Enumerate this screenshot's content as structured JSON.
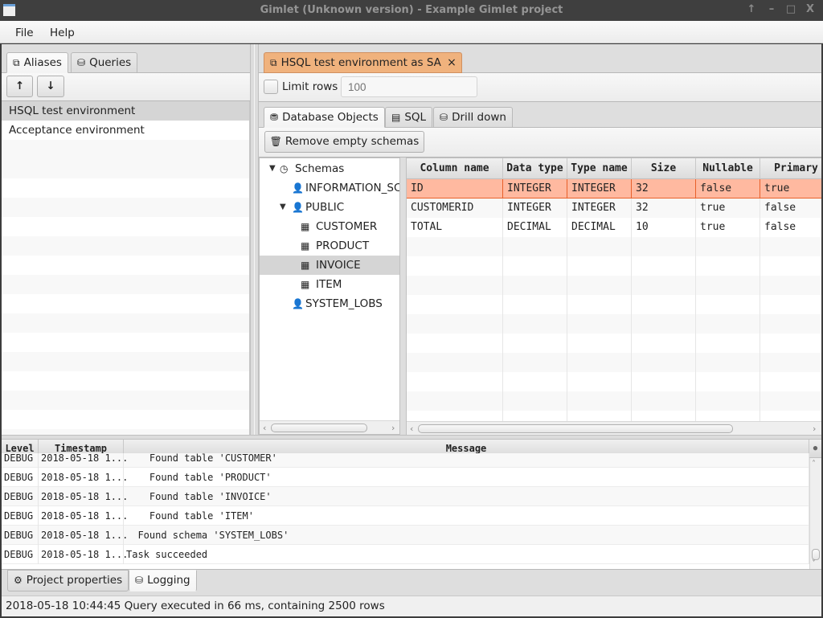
{
  "window": {
    "title": "Gimlet (Unknown version) - Example Gimlet project",
    "buttons": [
      "↑",
      "–",
      "□",
      "X"
    ]
  },
  "menubar": {
    "items": [
      "File",
      "Help"
    ]
  },
  "left_panel": {
    "tabs": [
      {
        "label": "Aliases",
        "icon": "network-icon",
        "active": true
      },
      {
        "label": "Queries",
        "icon": "db-search-icon",
        "active": false
      }
    ],
    "move_up_label": "↑",
    "move_down_label": "↓",
    "aliases": [
      {
        "label": "HSQL test environment",
        "selected": true
      },
      {
        "label": "Acceptance environment",
        "selected": false
      }
    ]
  },
  "right_panel": {
    "connection_tab": {
      "label": "HSQL test environment as SA",
      "close": "×",
      "accent": "#f0b27d"
    },
    "limit_rows": {
      "label": "Limit rows",
      "checked": false,
      "placeholder": "100",
      "value": ""
    },
    "sub_tabs": [
      {
        "label": "Database Objects",
        "icon": "database-icon",
        "active": true
      },
      {
        "label": "SQL",
        "icon": "sql-icon",
        "active": false
      },
      {
        "label": "Drill down",
        "icon": "db-search-icon",
        "active": false
      }
    ],
    "remove_empty_schemas_label": "Remove empty schemas",
    "tree": [
      {
        "label": "Schemas",
        "level": 0,
        "icon": "clock-icon",
        "expanded": true,
        "selected": false
      },
      {
        "label": "INFORMATION_SCHEMA",
        "level": 1,
        "icon": "user-icon",
        "selected": false
      },
      {
        "label": "PUBLIC",
        "level": 1,
        "icon": "user-icon",
        "expanded": true,
        "selected": false
      },
      {
        "label": "CUSTOMER",
        "level": 2,
        "icon": "table-icon",
        "selected": false
      },
      {
        "label": "PRODUCT",
        "level": 2,
        "icon": "table-icon",
        "selected": false
      },
      {
        "label": "INVOICE",
        "level": 2,
        "icon": "table-icon",
        "selected": true
      },
      {
        "label": "ITEM",
        "level": 2,
        "icon": "table-icon",
        "selected": false
      },
      {
        "label": "SYSTEM_LOBS",
        "level": 1,
        "icon": "user-icon",
        "selected": false
      }
    ],
    "columns_table": {
      "headers": [
        "Column name",
        "Data type",
        "Type name",
        "Size",
        "Nullable",
        "Primary"
      ],
      "rows": [
        [
          "ID",
          "INTEGER",
          "INTEGER",
          "32",
          "false",
          "true"
        ],
        [
          "CUSTOMERID",
          "INTEGER",
          "INTEGER",
          "32",
          "true",
          "false"
        ],
        [
          "TOTAL",
          "DECIMAL",
          "DECIMAL",
          "10",
          "true",
          "false"
        ]
      ],
      "highlight_row": 0,
      "highlight_color": "#ffb9a0"
    }
  },
  "log": {
    "headers": [
      "Level",
      "Timestamp",
      "Message"
    ],
    "rows": [
      [
        "DEBUG",
        "2018-05-18 1...",
        "    Found table 'CUSTOMER'"
      ],
      [
        "DEBUG",
        "2018-05-18 1...",
        "    Found table 'PRODUCT'"
      ],
      [
        "DEBUG",
        "2018-05-18 1...",
        "    Found table 'INVOICE'"
      ],
      [
        "DEBUG",
        "2018-05-18 1...",
        "    Found table 'ITEM'"
      ],
      [
        "DEBUG",
        "2018-05-18 1...",
        "  Found schema 'SYSTEM_LOBS'"
      ],
      [
        "DEBUG",
        "2018-05-18 1...",
        "Task succeeded"
      ]
    ]
  },
  "bottom_tabs": [
    {
      "label": "Project properties",
      "icon": "gear-icon",
      "active": false
    },
    {
      "label": "Logging",
      "icon": "db-search-icon",
      "active": true
    }
  ],
  "status": "2018-05-18 10:44:45 Query executed in 66 ms, containing 2500 rows"
}
